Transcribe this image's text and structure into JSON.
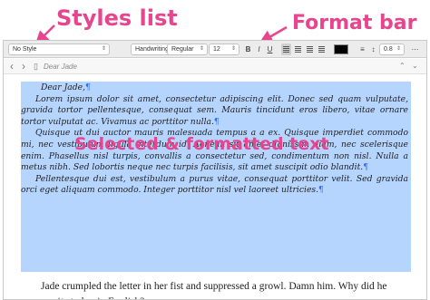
{
  "callouts": {
    "styles_list": "Styles list",
    "format_bar": "Format bar",
    "selected_text": "Selected & formatted text"
  },
  "format_bar": {
    "style": "No Style",
    "font": "Handwriting - Da...",
    "weight": "Regular",
    "size": "12",
    "bold": "B",
    "italic": "I",
    "underline": "U",
    "line_spacing": "0.8",
    "text_color": "#000000"
  },
  "nav": {
    "back": "‹",
    "forward": "›",
    "document_title": "Dear Jade"
  },
  "editor": {
    "greeting": "Dear Jade,",
    "paragraph_1": "Lorem ipsum dolor sit amet, consectetur adipiscing elit. Donec sed quam vulputate, gravida tortor pellentesque, consequat sem. Mauris tincidunt eros libero, vitae ornare tortor vulputat ac. Vivamus ac porttitor nulla.",
    "paragraph_2": "Quisque ut dui auctor mauris malesuada tempus a a ex. Quisque imperdiet commodo mi, nec vestibulum ligula interdum id. Aenean sit amet dignissim diam, nec scelerisque enim. Phasellus nisl turpis, convallis a consectetur sed, condimentum non nisl. Nulla a metus nibh. Sed lobortis neque nec turpis facilisis, sit amet suscipit odio blandit.",
    "paragraph_3": "Pellentesque dui est, vestibulum a purus vitae, consequat porttitor velit. Sed gravida orci eget aliquam commodo. Integer porttitor nisl vel laoreet ultricies.",
    "pilcrow": "¶",
    "unformatted": "Jade crumpled the letter in her fist and suppressed a growl. Damn him. Why did he never write to her in English?"
  },
  "colors": {
    "callout": "#e8458f",
    "selection": "#b5d5ff",
    "pilcrow": "#2f6ee8"
  }
}
